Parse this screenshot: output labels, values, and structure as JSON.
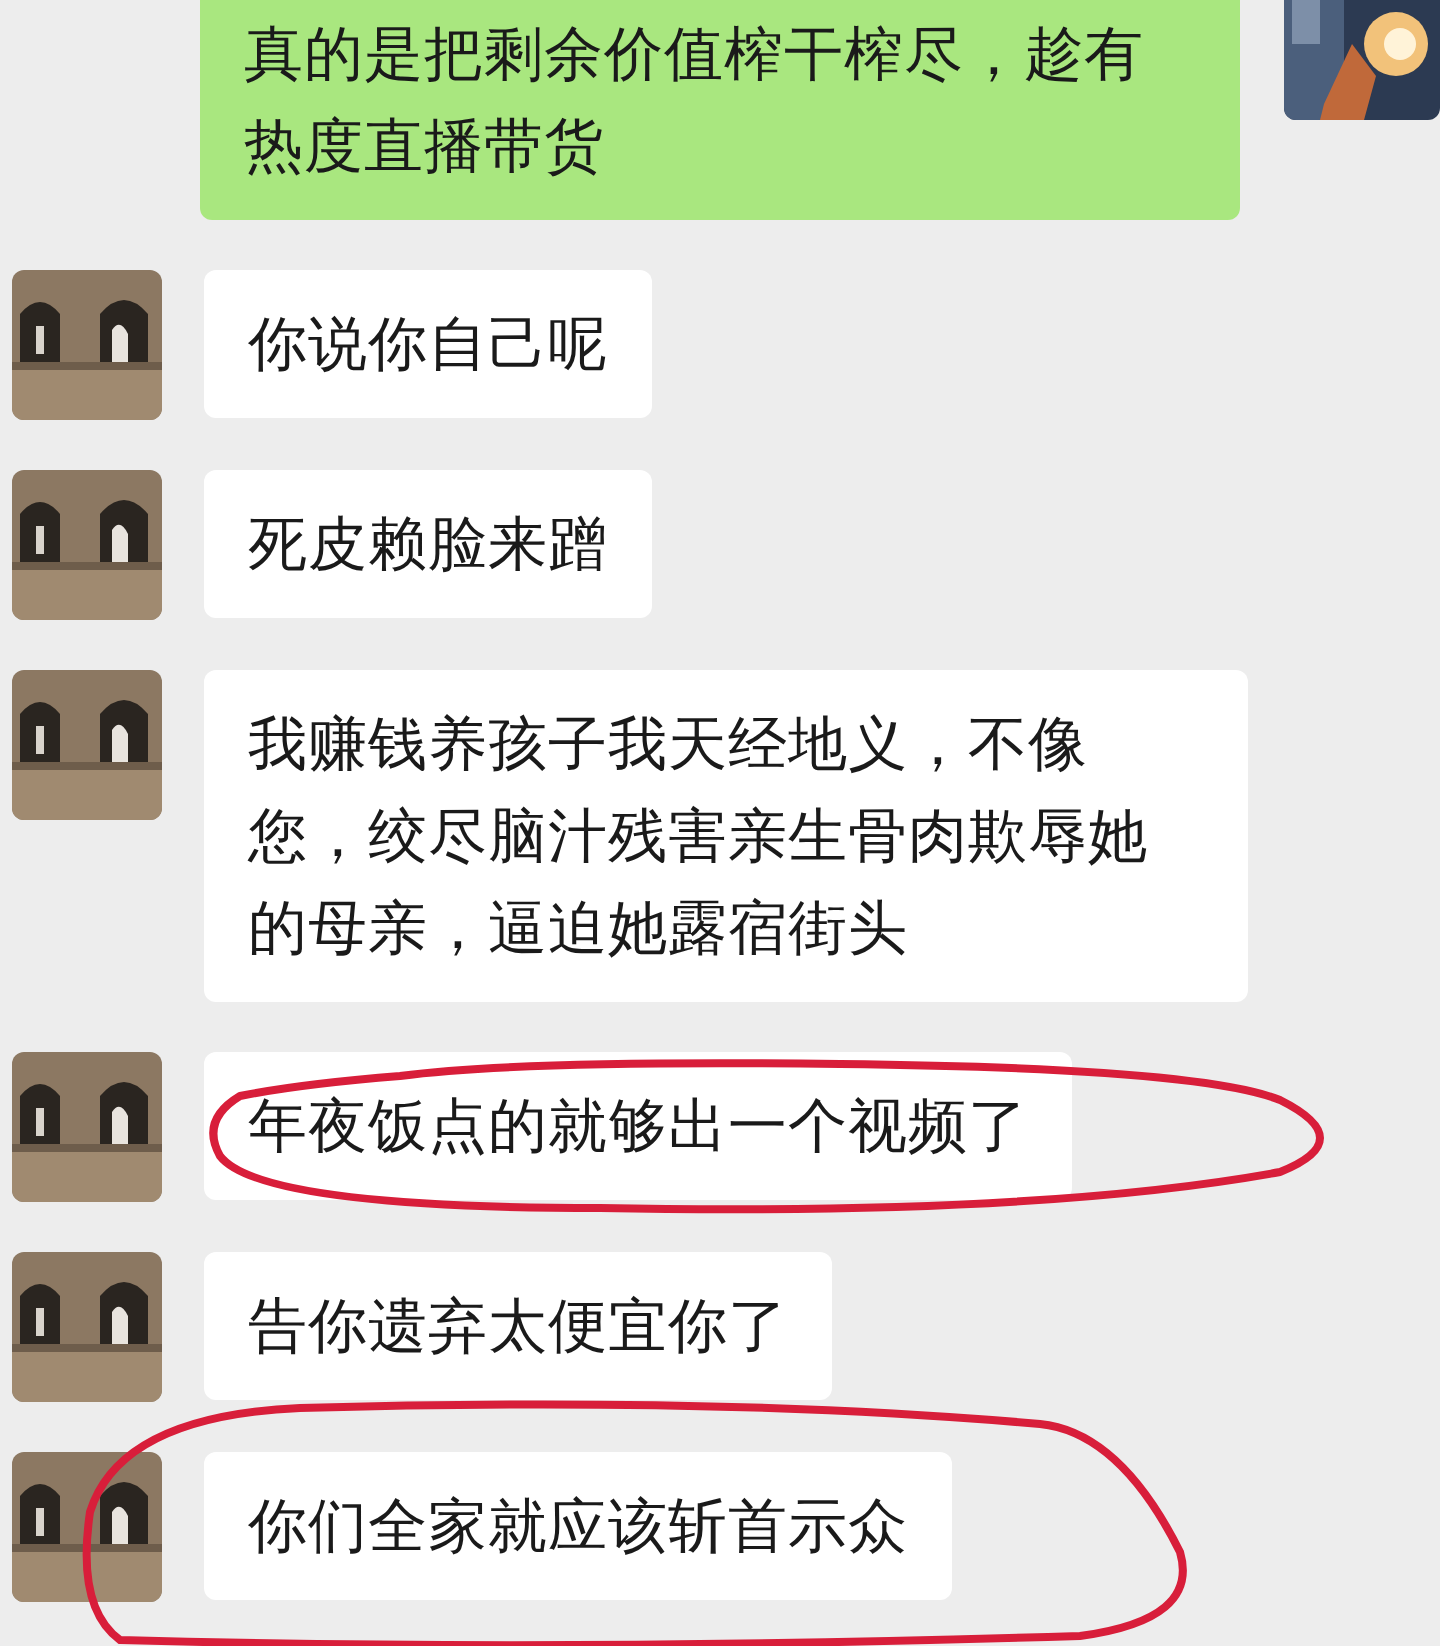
{
  "messages": [
    {
      "kind": "sent",
      "text": "真的是把剩余价值榨干榨尽，趁有热度直播带货",
      "circled": false
    },
    {
      "kind": "received",
      "text": "你说你自己呢",
      "circled": false
    },
    {
      "kind": "received",
      "text": "死皮赖脸来蹭",
      "circled": false
    },
    {
      "kind": "received",
      "text": "我赚钱养孩子我天经地义，不像您，绞尽脑汁残害亲生骨肉欺辱她的母亲，逼迫她露宿街头",
      "circled": false
    },
    {
      "kind": "received",
      "text": "年夜饭点的就够出一个视频了",
      "circled": true
    },
    {
      "kind": "received",
      "text": "告你遗弃太便宜你了",
      "circled": false
    },
    {
      "kind": "received",
      "text": "你们全家就应该斩首示众",
      "circled": true
    }
  ]
}
